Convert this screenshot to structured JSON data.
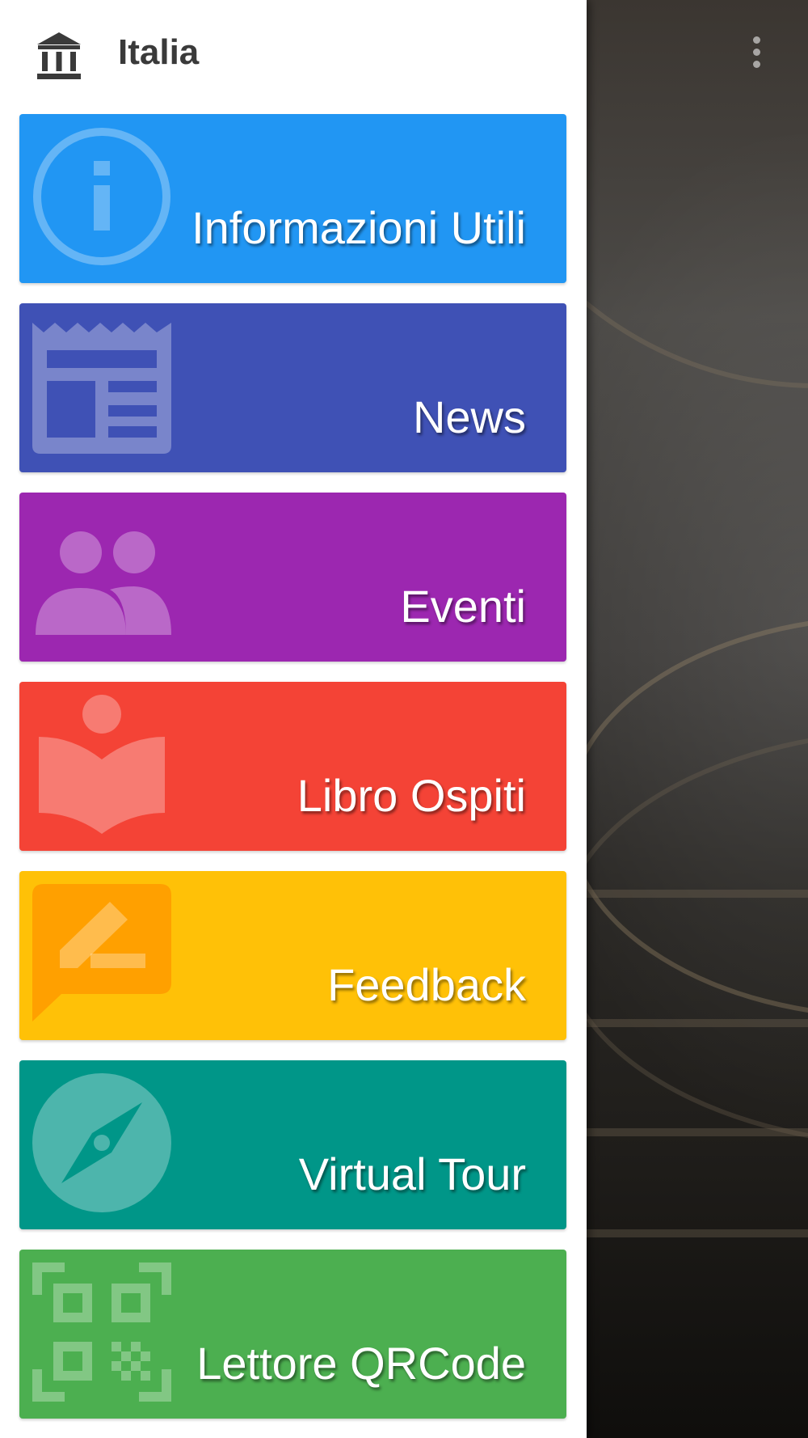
{
  "header": {
    "title": "Italia",
    "icon": "museum-icon"
  },
  "menu": [
    {
      "label": "Informazioni Utili",
      "color": "#2196F3",
      "icon": "info-icon"
    },
    {
      "label": "News",
      "color": "#3F51B5",
      "icon": "newspaper-icon"
    },
    {
      "label": "Eventi",
      "color": "#9C27B0",
      "icon": "people-icon"
    },
    {
      "label": "Libro Ospiti",
      "color": "#F44336",
      "icon": "reader-book-icon"
    },
    {
      "label": "Feedback",
      "color": "#FFC107",
      "icon": "feedback-icon"
    },
    {
      "label": "Virtual Tour",
      "color": "#009688",
      "icon": "compass-icon"
    },
    {
      "label": "Lettore QRCode",
      "color": "#4CAF50",
      "icon": "qr-code-icon"
    }
  ],
  "overflow_icon": "more-vertical-icon"
}
